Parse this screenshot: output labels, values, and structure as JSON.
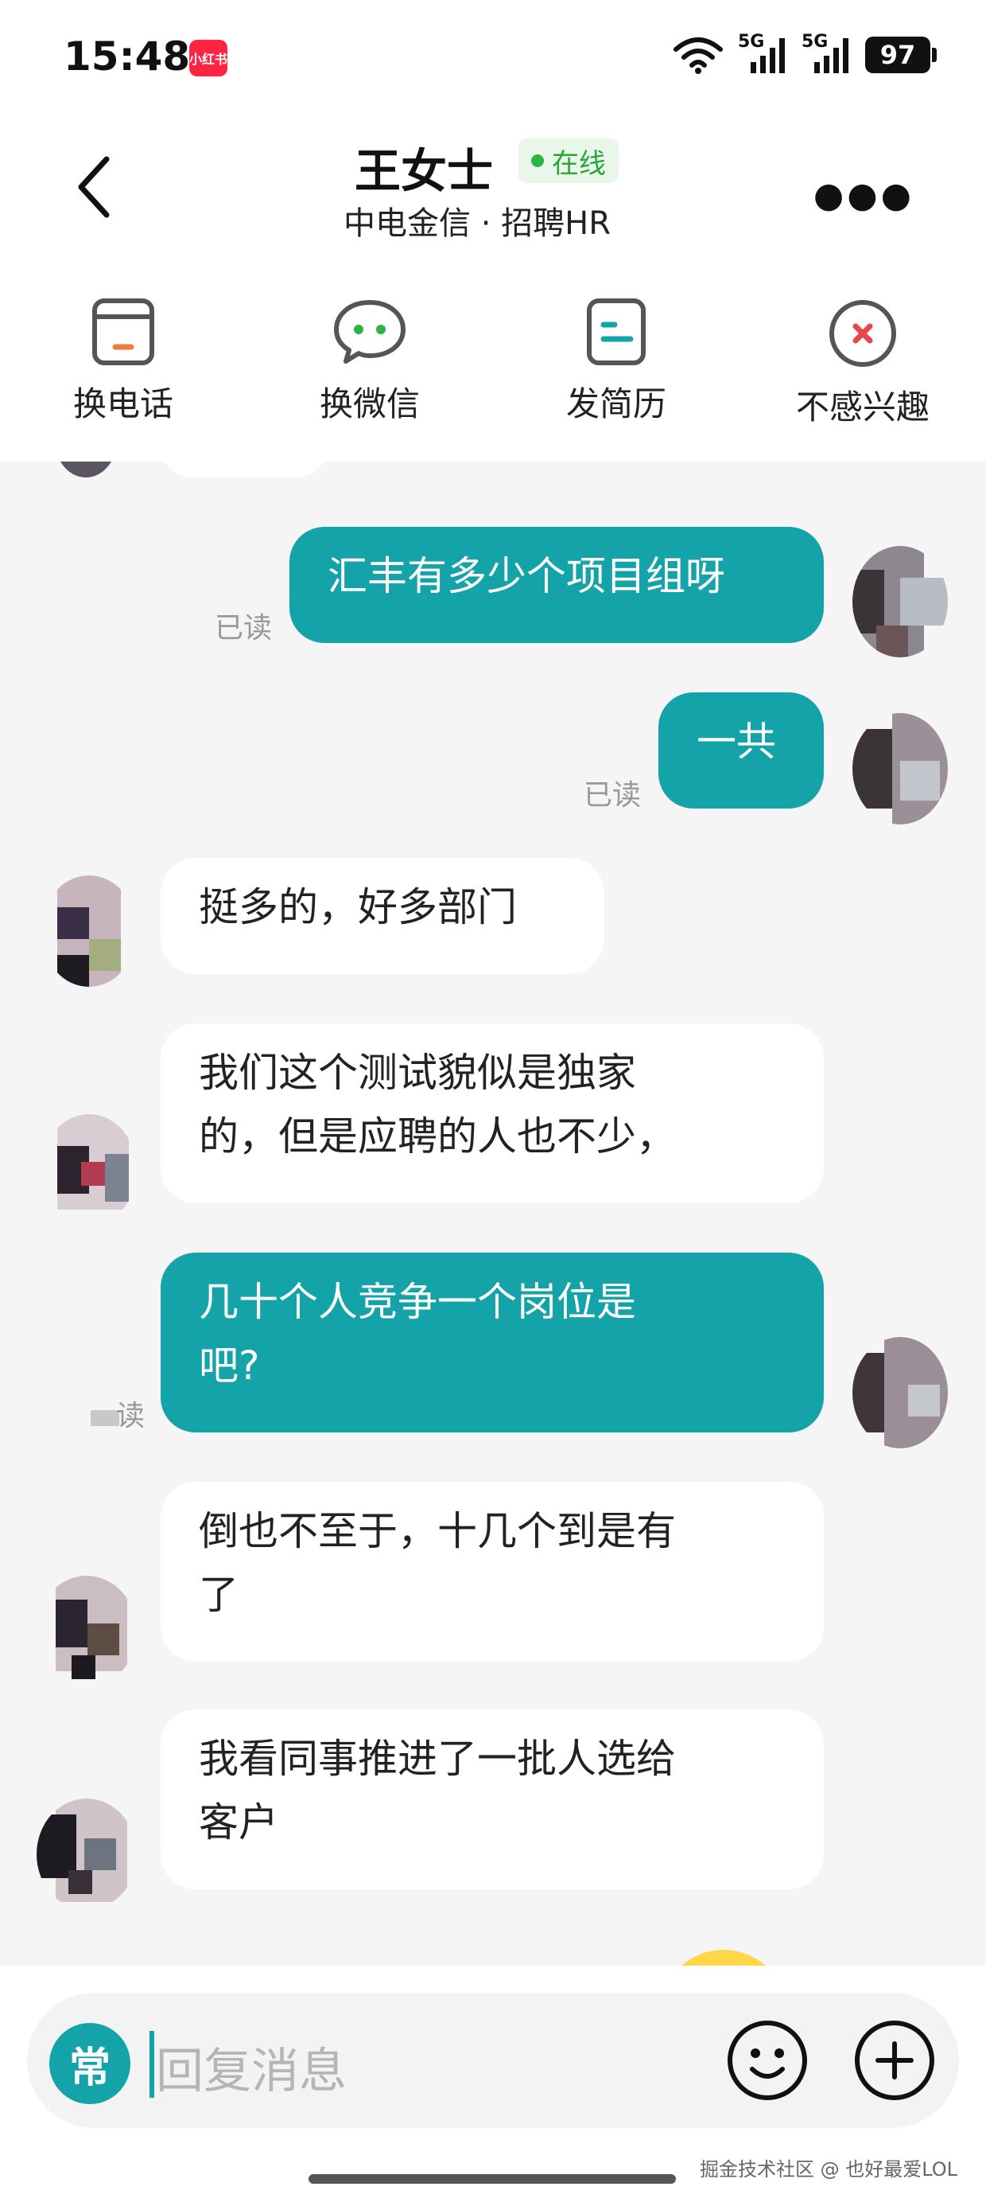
{
  "status_bar": {
    "time": "15:48",
    "app_badge": "小红书",
    "network1": "5G",
    "network2": "5G",
    "battery": "97"
  },
  "header": {
    "name": "王女士",
    "online_label": "在线",
    "subtitle": "中电金信 · 招聘HR"
  },
  "actions": [
    {
      "label": "换电话",
      "icon": "phone-icon"
    },
    {
      "label": "换微信",
      "icon": "wechat-icon"
    },
    {
      "label": "发简历",
      "icon": "resume-icon"
    },
    {
      "label": "不感兴趣",
      "icon": "not-interested-icon"
    }
  ],
  "messages": [
    {
      "from": "me",
      "lines": [
        "汇丰有多少个项目组呀"
      ],
      "read": "已读"
    },
    {
      "from": "me",
      "lines": [
        "一共"
      ],
      "read": "已读"
    },
    {
      "from": "them",
      "lines": [
        "挺多的，好多部门"
      ]
    },
    {
      "from": "them",
      "lines": [
        "我们这个测试貌似是独家",
        "的，但是应聘的人也不少，"
      ]
    },
    {
      "from": "me",
      "lines": [
        "几十个人竞争一个岗位是",
        "吧?"
      ],
      "read": "读"
    },
    {
      "from": "them",
      "lines": [
        "倒也不至于，十几个到是有",
        "了"
      ]
    },
    {
      "from": "them",
      "lines": [
        "我看同事推进了一批人选给",
        "客户"
      ]
    }
  ],
  "input": {
    "common_label": "常",
    "placeholder": "回复消息"
  },
  "watermark": "掘金技术社区 @ 也好最爱LOL",
  "colors": {
    "accent": "#13a3a8",
    "online": "#2fb246",
    "bubble_them": "#ffffff",
    "background": "#f5f5f5"
  }
}
